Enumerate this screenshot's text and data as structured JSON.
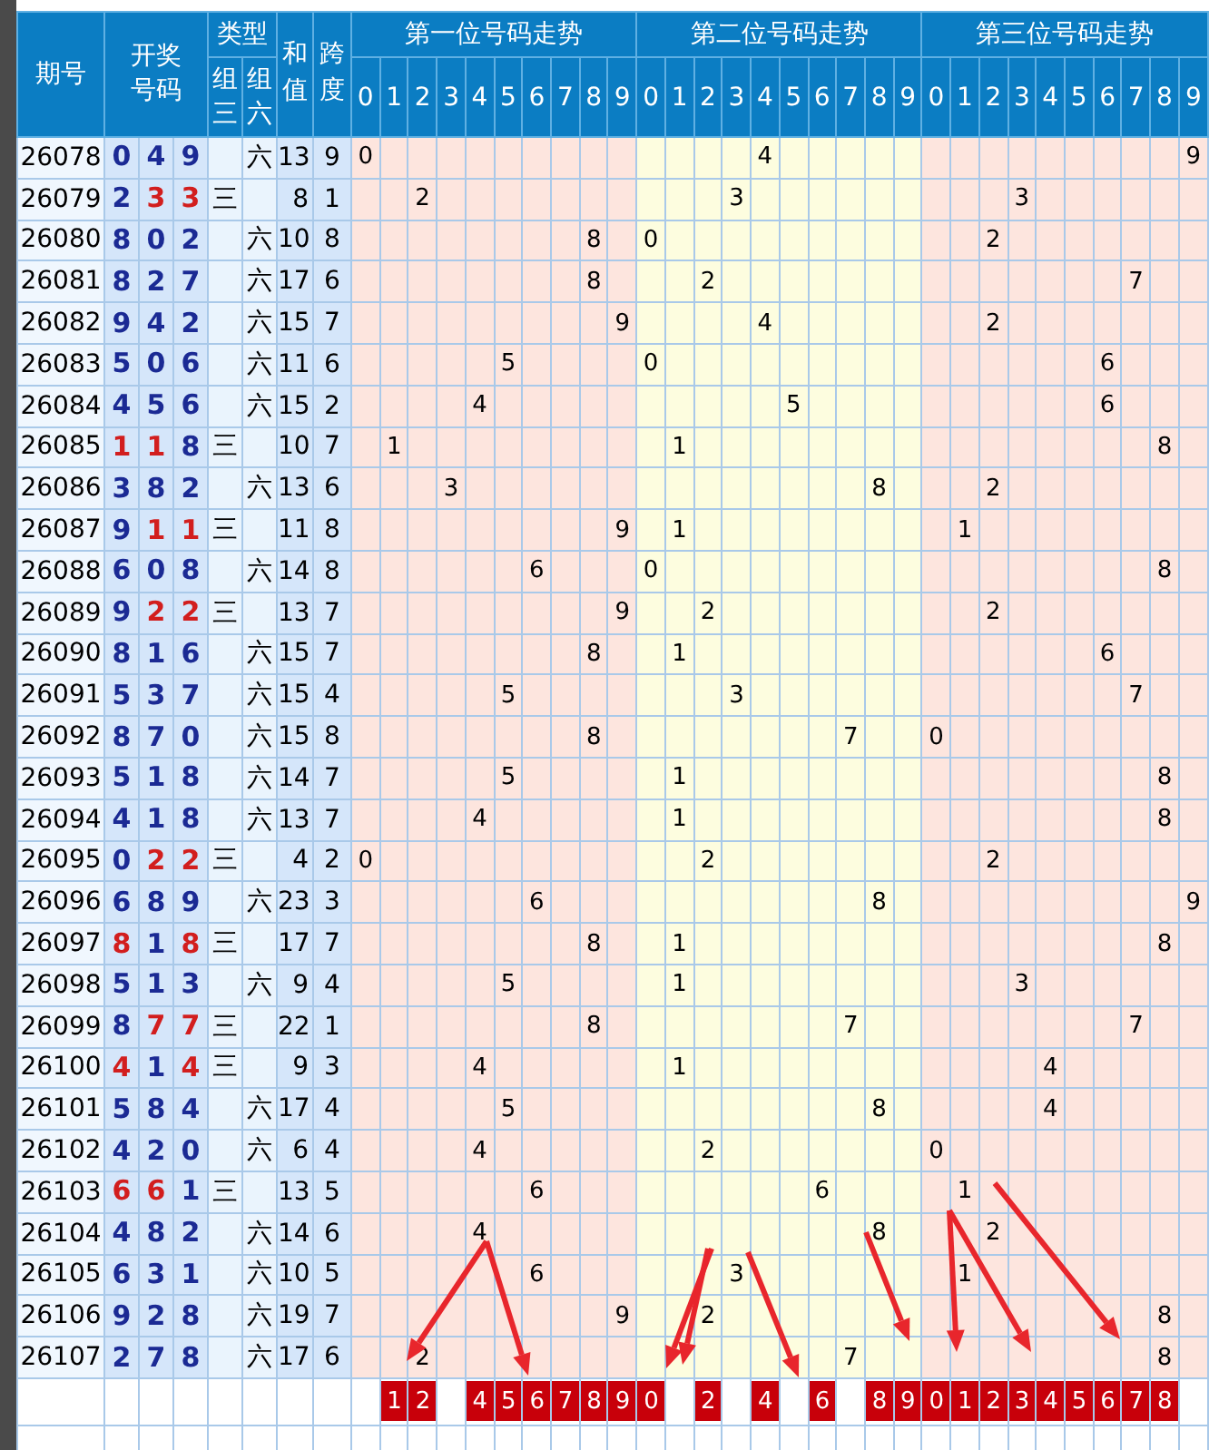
{
  "header": {
    "period": "期号",
    "numbers": "开奖号码",
    "type": "类型",
    "type_columns": [
      "组三",
      "组六"
    ],
    "sum": "和值",
    "span": "跨度",
    "positions": [
      {
        "title": "第一位号码走势",
        "digits": [
          "0",
          "1",
          "2",
          "3",
          "4",
          "5",
          "6",
          "7",
          "8",
          "9"
        ]
      },
      {
        "title": "第二位号码走势",
        "digits": [
          "0",
          "1",
          "2",
          "3",
          "4",
          "5",
          "6",
          "7",
          "8",
          "9"
        ]
      },
      {
        "title": "第三位号码走势",
        "digits": [
          "0",
          "1",
          "2",
          "3",
          "4",
          "5",
          "6",
          "7",
          "8",
          "9"
        ]
      }
    ]
  },
  "rows": [
    {
      "period": "26078",
      "digits": [
        {
          "text": "0",
          "repeat": false
        },
        {
          "text": "4",
          "repeat": false
        },
        {
          "text": "9",
          "repeat": false
        }
      ],
      "type": {
        "kind": "group6",
        "label": "六"
      },
      "sum": "13",
      "span": "9",
      "trend": [
        {
          "col_0": "0"
        },
        {
          "col_4": "4"
        },
        {
          "col_9": "9"
        }
      ]
    },
    {
      "period": "26079",
      "digits": [
        {
          "text": "2",
          "repeat": false
        },
        {
          "text": "3",
          "repeat": true
        },
        {
          "text": "3",
          "repeat": true
        }
      ],
      "type": {
        "kind": "group3",
        "label": "三"
      },
      "sum": "8",
      "span": "1",
      "trend": [
        {
          "col_2": "2"
        },
        {
          "col_3": "3"
        },
        {
          "col_3": "3"
        }
      ]
    },
    {
      "period": "26080",
      "digits": [
        {
          "text": "8",
          "repeat": false
        },
        {
          "text": "0",
          "repeat": false
        },
        {
          "text": "2",
          "repeat": false
        }
      ],
      "type": {
        "kind": "group6",
        "label": "六"
      },
      "sum": "10",
      "span": "8",
      "trend": [
        {
          "col_8": "8"
        },
        {
          "col_0": "0"
        },
        {
          "col_2": "2"
        }
      ]
    },
    {
      "period": "26081",
      "digits": [
        {
          "text": "8",
          "repeat": false
        },
        {
          "text": "2",
          "repeat": false
        },
        {
          "text": "7",
          "repeat": false
        }
      ],
      "type": {
        "kind": "group6",
        "label": "六"
      },
      "sum": "17",
      "span": "6",
      "trend": [
        {
          "col_8": "8"
        },
        {
          "col_2": "2"
        },
        {
          "col_7": "7"
        }
      ]
    },
    {
      "period": "26082",
      "digits": [
        {
          "text": "9",
          "repeat": false
        },
        {
          "text": "4",
          "repeat": false
        },
        {
          "text": "2",
          "repeat": false
        }
      ],
      "type": {
        "kind": "group6",
        "label": "六"
      },
      "sum": "15",
      "span": "7",
      "trend": [
        {
          "col_9": "9"
        },
        {
          "col_4": "4"
        },
        {
          "col_2": "2"
        }
      ]
    },
    {
      "period": "26083",
      "digits": [
        {
          "text": "5",
          "repeat": false
        },
        {
          "text": "0",
          "repeat": false
        },
        {
          "text": "6",
          "repeat": false
        }
      ],
      "type": {
        "kind": "group6",
        "label": "六"
      },
      "sum": "11",
      "span": "6",
      "trend": [
        {
          "col_5": "5"
        },
        {
          "col_0": "0"
        },
        {
          "col_6": "6"
        }
      ]
    },
    {
      "period": "26084",
      "digits": [
        {
          "text": "4",
          "repeat": false
        },
        {
          "text": "5",
          "repeat": false
        },
        {
          "text": "6",
          "repeat": false
        }
      ],
      "type": {
        "kind": "group6",
        "label": "六"
      },
      "sum": "15",
      "span": "2",
      "trend": [
        {
          "col_4": "4"
        },
        {
          "col_5": "5"
        },
        {
          "col_6": "6"
        }
      ]
    },
    {
      "period": "26085",
      "digits": [
        {
          "text": "1",
          "repeat": true
        },
        {
          "text": "1",
          "repeat": true
        },
        {
          "text": "8",
          "repeat": false
        }
      ],
      "type": {
        "kind": "group3",
        "label": "三"
      },
      "sum": "10",
      "span": "7",
      "trend": [
        {
          "col_1": "1"
        },
        {
          "col_1": "1"
        },
        {
          "col_8": "8"
        }
      ]
    },
    {
      "period": "26086",
      "digits": [
        {
          "text": "3",
          "repeat": false
        },
        {
          "text": "8",
          "repeat": false
        },
        {
          "text": "2",
          "repeat": false
        }
      ],
      "type": {
        "kind": "group6",
        "label": "六"
      },
      "sum": "13",
      "span": "6",
      "trend": [
        {
          "col_3": "3"
        },
        {
          "col_8": "8"
        },
        {
          "col_2": "2"
        }
      ]
    },
    {
      "period": "26087",
      "digits": [
        {
          "text": "9",
          "repeat": false
        },
        {
          "text": "1",
          "repeat": true
        },
        {
          "text": "1",
          "repeat": true
        }
      ],
      "type": {
        "kind": "group3",
        "label": "三"
      },
      "sum": "11",
      "span": "8",
      "trend": [
        {
          "col_9": "9"
        },
        {
          "col_1": "1"
        },
        {
          "col_1": "1"
        }
      ]
    },
    {
      "period": "26088",
      "digits": [
        {
          "text": "6",
          "repeat": false
        },
        {
          "text": "0",
          "repeat": false
        },
        {
          "text": "8",
          "repeat": false
        }
      ],
      "type": {
        "kind": "group6",
        "label": "六"
      },
      "sum": "14",
      "span": "8",
      "trend": [
        {
          "col_6": "6"
        },
        {
          "col_0": "0"
        },
        {
          "col_8": "8"
        }
      ]
    },
    {
      "period": "26089",
      "digits": [
        {
          "text": "9",
          "repeat": false
        },
        {
          "text": "2",
          "repeat": true
        },
        {
          "text": "2",
          "repeat": true
        }
      ],
      "type": {
        "kind": "group3",
        "label": "三"
      },
      "sum": "13",
      "span": "7",
      "trend": [
        {
          "col_9": "9"
        },
        {
          "col_2": "2"
        },
        {
          "col_2": "2"
        }
      ]
    },
    {
      "period": "26090",
      "digits": [
        {
          "text": "8",
          "repeat": false
        },
        {
          "text": "1",
          "repeat": false
        },
        {
          "text": "6",
          "repeat": false
        }
      ],
      "type": {
        "kind": "group6",
        "label": "六"
      },
      "sum": "15",
      "span": "7",
      "trend": [
        {
          "col_8": "8"
        },
        {
          "col_1": "1"
        },
        {
          "col_6": "6"
        }
      ]
    },
    {
      "period": "26091",
      "digits": [
        {
          "text": "5",
          "repeat": false
        },
        {
          "text": "3",
          "repeat": false
        },
        {
          "text": "7",
          "repeat": false
        }
      ],
      "type": {
        "kind": "group6",
        "label": "六"
      },
      "sum": "15",
      "span": "4",
      "trend": [
        {
          "col_5": "5"
        },
        {
          "col_3": "3"
        },
        {
          "col_7": "7"
        }
      ]
    },
    {
      "period": "26092",
      "digits": [
        {
          "text": "8",
          "repeat": false
        },
        {
          "text": "7",
          "repeat": false
        },
        {
          "text": "0",
          "repeat": false
        }
      ],
      "type": {
        "kind": "group6",
        "label": "六"
      },
      "sum": "15",
      "span": "8",
      "trend": [
        {
          "col_8": "8"
        },
        {
          "col_7": "7"
        },
        {
          "col_0": "0"
        }
      ]
    },
    {
      "period": "26093",
      "digits": [
        {
          "text": "5",
          "repeat": false
        },
        {
          "text": "1",
          "repeat": false
        },
        {
          "text": "8",
          "repeat": false
        }
      ],
      "type": {
        "kind": "group6",
        "label": "六"
      },
      "sum": "14",
      "span": "7",
      "trend": [
        {
          "col_5": "5"
        },
        {
          "col_1": "1"
        },
        {
          "col_8": "8"
        }
      ]
    },
    {
      "period": "26094",
      "digits": [
        {
          "text": "4",
          "repeat": false
        },
        {
          "text": "1",
          "repeat": false
        },
        {
          "text": "8",
          "repeat": false
        }
      ],
      "type": {
        "kind": "group6",
        "label": "六"
      },
      "sum": "13",
      "span": "7",
      "trend": [
        {
          "col_4": "4"
        },
        {
          "col_1": "1"
        },
        {
          "col_8": "8"
        }
      ]
    },
    {
      "period": "26095",
      "digits": [
        {
          "text": "0",
          "repeat": false
        },
        {
          "text": "2",
          "repeat": true
        },
        {
          "text": "2",
          "repeat": true
        }
      ],
      "type": {
        "kind": "group3",
        "label": "三"
      },
      "sum": "4",
      "span": "2",
      "trend": [
        {
          "col_0": "0"
        },
        {
          "col_2": "2"
        },
        {
          "col_2": "2"
        }
      ]
    },
    {
      "period": "26096",
      "digits": [
        {
          "text": "6",
          "repeat": false
        },
        {
          "text": "8",
          "repeat": false
        },
        {
          "text": "9",
          "repeat": false
        }
      ],
      "type": {
        "kind": "group6",
        "label": "六"
      },
      "sum": "23",
      "span": "3",
      "trend": [
        {
          "col_6": "6"
        },
        {
          "col_8": "8"
        },
        {
          "col_9": "9"
        }
      ]
    },
    {
      "period": "26097",
      "digits": [
        {
          "text": "8",
          "repeat": true
        },
        {
          "text": "1",
          "repeat": false
        },
        {
          "text": "8",
          "repeat": true
        }
      ],
      "type": {
        "kind": "group3",
        "label": "三"
      },
      "sum": "17",
      "span": "7",
      "trend": [
        {
          "col_8": "8"
        },
        {
          "col_1": "1"
        },
        {
          "col_8": "8"
        }
      ]
    },
    {
      "period": "26098",
      "digits": [
        {
          "text": "5",
          "repeat": false
        },
        {
          "text": "1",
          "repeat": false
        },
        {
          "text": "3",
          "repeat": false
        }
      ],
      "type": {
        "kind": "group6",
        "label": "六"
      },
      "sum": "9",
      "span": "4",
      "trend": [
        {
          "col_5": "5"
        },
        {
          "col_1": "1"
        },
        {
          "col_3": "3"
        }
      ]
    },
    {
      "period": "26099",
      "digits": [
        {
          "text": "8",
          "repeat": false
        },
        {
          "text": "7",
          "repeat": true
        },
        {
          "text": "7",
          "repeat": true
        }
      ],
      "type": {
        "kind": "group3",
        "label": "三"
      },
      "sum": "22",
      "span": "1",
      "trend": [
        {
          "col_8": "8"
        },
        {
          "col_7": "7"
        },
        {
          "col_7": "7"
        }
      ]
    },
    {
      "period": "26100",
      "digits": [
        {
          "text": "4",
          "repeat": true
        },
        {
          "text": "1",
          "repeat": false
        },
        {
          "text": "4",
          "repeat": true
        }
      ],
      "type": {
        "kind": "group3",
        "label": "三"
      },
      "sum": "9",
      "span": "3",
      "trend": [
        {
          "col_4": "4"
        },
        {
          "col_1": "1"
        },
        {
          "col_4": "4"
        }
      ]
    },
    {
      "period": "26101",
      "digits": [
        {
          "text": "5",
          "repeat": false
        },
        {
          "text": "8",
          "repeat": false
        },
        {
          "text": "4",
          "repeat": false
        }
      ],
      "type": {
        "kind": "group6",
        "label": "六"
      },
      "sum": "17",
      "span": "4",
      "trend": [
        {
          "col_5": "5"
        },
        {
          "col_8": "8"
        },
        {
          "col_4": "4"
        }
      ]
    },
    {
      "period": "26102",
      "digits": [
        {
          "text": "4",
          "repeat": false
        },
        {
          "text": "2",
          "repeat": false
        },
        {
          "text": "0",
          "repeat": false
        }
      ],
      "type": {
        "kind": "group6",
        "label": "六"
      },
      "sum": "6",
      "span": "4",
      "trend": [
        {
          "col_4": "4"
        },
        {
          "col_2": "2"
        },
        {
          "col_0": "0"
        }
      ]
    },
    {
      "period": "26103",
      "digits": [
        {
          "text": "6",
          "repeat": true
        },
        {
          "text": "6",
          "repeat": true
        },
        {
          "text": "1",
          "repeat": false
        }
      ],
      "type": {
        "kind": "group3",
        "label": "三"
      },
      "sum": "13",
      "span": "5",
      "trend": [
        {
          "col_6": "6"
        },
        {
          "col_6": "6"
        },
        {
          "col_1": "1"
        }
      ]
    },
    {
      "period": "26104",
      "digits": [
        {
          "text": "4",
          "repeat": false
        },
        {
          "text": "8",
          "repeat": false
        },
        {
          "text": "2",
          "repeat": false
        }
      ],
      "type": {
        "kind": "group6",
        "label": "六"
      },
      "sum": "14",
      "span": "6",
      "trend": [
        {
          "col_4": "4"
        },
        {
          "col_8": "8"
        },
        {
          "col_2": "2"
        }
      ]
    },
    {
      "period": "26105",
      "digits": [
        {
          "text": "6",
          "repeat": false
        },
        {
          "text": "3",
          "repeat": false
        },
        {
          "text": "1",
          "repeat": false
        }
      ],
      "type": {
        "kind": "group6",
        "label": "六"
      },
      "sum": "10",
      "span": "5",
      "trend": [
        {
          "col_6": "6"
        },
        {
          "col_3": "3"
        },
        {
          "col_1": "1"
        }
      ]
    },
    {
      "period": "26106",
      "digits": [
        {
          "text": "9",
          "repeat": false
        },
        {
          "text": "2",
          "repeat": false
        },
        {
          "text": "8",
          "repeat": false
        }
      ],
      "type": {
        "kind": "group6",
        "label": "六"
      },
      "sum": "19",
      "span": "7",
      "trend": [
        {
          "col_9": "9"
        },
        {
          "col_2": "2"
        },
        {
          "col_8": "8"
        }
      ]
    },
    {
      "period": "26107",
      "digits": [
        {
          "text": "2",
          "repeat": false
        },
        {
          "text": "7",
          "repeat": false
        },
        {
          "text": "8",
          "repeat": false
        }
      ],
      "type": {
        "kind": "group6",
        "label": "六"
      },
      "sum": "17",
      "span": "6",
      "trend": [
        {
          "col_2": "2"
        },
        {
          "col_7": "7"
        },
        {
          "col_8": "8"
        }
      ]
    }
  ],
  "tally": [
    {
      "col_1": "1",
      "col_2": "2",
      "col_4": "4",
      "col_5": "5",
      "col_6": "6",
      "col_7": "7",
      "col_8": "8",
      "col_9": "9"
    },
    {
      "col_0": "0",
      "col_2": "2",
      "col_4": "4",
      "col_6": "6",
      "col_8": "8",
      "col_9": "9"
    },
    {
      "col_0": "0",
      "col_1": "1",
      "col_2": "2",
      "col_3": "3",
      "col_4": "4",
      "col_5": "5",
      "col_6": "6",
      "col_7": "7",
      "col_8": "8"
    }
  ]
}
